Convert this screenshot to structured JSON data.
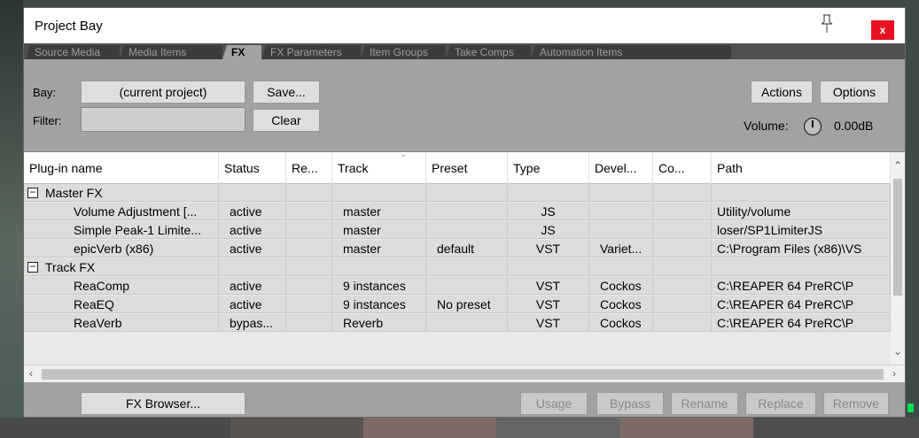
{
  "window": {
    "title": "Project Bay",
    "close_label": "x"
  },
  "tabs": [
    {
      "label": "Source Media"
    },
    {
      "label": "Media Items"
    },
    {
      "label": "FX"
    },
    {
      "label": "FX Parameters"
    },
    {
      "label": "Item Groups"
    },
    {
      "label": "Take Comps"
    },
    {
      "label": "Automation Items"
    }
  ],
  "active_tab": "FX",
  "toolbar": {
    "bay_label": "Bay:",
    "bay_value": "(current project)",
    "save_label": "Save...",
    "filter_label": "Filter:",
    "filter_value": "",
    "clear_label": "Clear",
    "actions_label": "Actions",
    "options_label": "Options",
    "volume_label": "Volume:",
    "volume_value": "0.00dB"
  },
  "table": {
    "columns": [
      "Plug-in name",
      "Status",
      "Re...",
      "Track",
      "Preset",
      "Type",
      "Devel...",
      "Co...",
      "Path"
    ],
    "rows": [
      {
        "group": true,
        "name": "Master FX"
      },
      {
        "name": "Volume Adjustment [...",
        "status": "active",
        "re": "",
        "track": "master",
        "preset": "",
        "type": "JS",
        "devel": "",
        "co": "",
        "path": "Utility/volume"
      },
      {
        "name": "Simple Peak-1 Limite...",
        "status": "active",
        "re": "",
        "track": "master",
        "preset": "",
        "type": "JS",
        "devel": "",
        "co": "",
        "path": "loser/SP1LimiterJS"
      },
      {
        "name": "epicVerb (x86)",
        "status": "active",
        "re": "",
        "track": "master",
        "preset": "default",
        "type": "VST",
        "devel": "Variet...",
        "co": "",
        "path": "C:\\Program Files (x86)\\VS"
      },
      {
        "group": true,
        "name": "Track FX"
      },
      {
        "name": "ReaComp",
        "status": "active",
        "re": "",
        "track": "9 instances",
        "preset": "",
        "type": "VST",
        "devel": "Cockos",
        "co": "",
        "path": "C:\\REAPER 64 PreRC\\P"
      },
      {
        "name": "ReaEQ",
        "status": "active",
        "re": "",
        "track": "9 instances",
        "preset": "No preset",
        "type": "VST",
        "devel": "Cockos",
        "co": "",
        "path": "C:\\REAPER 64 PreRC\\P"
      },
      {
        "name": "ReaVerb",
        "status": "bypas...",
        "re": "",
        "track": "Reverb",
        "preset": "",
        "type": "VST",
        "devel": "Cockos",
        "co": "",
        "path": "C:\\REAPER 64 PreRC\\P"
      }
    ]
  },
  "footer": {
    "fx_browser_label": "FX Browser...",
    "usage_label": "Usage",
    "bypass_label": "Bypass",
    "rename_label": "Rename",
    "replace_label": "Replace",
    "remove_label": "Remove"
  }
}
